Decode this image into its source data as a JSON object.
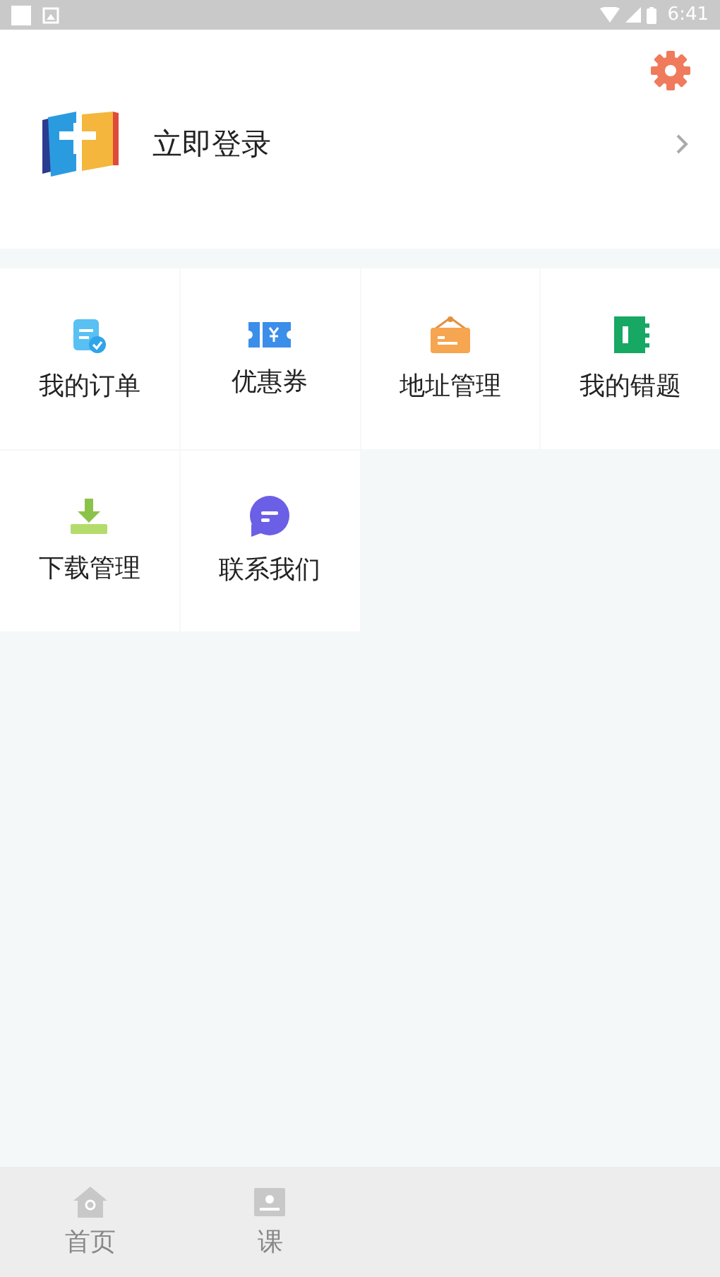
{
  "status_bar": {
    "time": "6:41"
  },
  "profile": {
    "login_label": "立即登录"
  },
  "menu": [
    {
      "label": "我的订单",
      "kind": "order"
    },
    {
      "label": "优惠券",
      "kind": "coupon"
    },
    {
      "label": "地址管理",
      "kind": "address"
    },
    {
      "label": "我的错题",
      "kind": "mistakes"
    },
    {
      "label": "下载管理",
      "kind": "download"
    },
    {
      "label": "联系我们",
      "kind": "contact"
    }
  ],
  "tab_bar": [
    {
      "label": "首页",
      "kind": "home"
    },
    {
      "label": "课",
      "kind": "course"
    }
  ]
}
